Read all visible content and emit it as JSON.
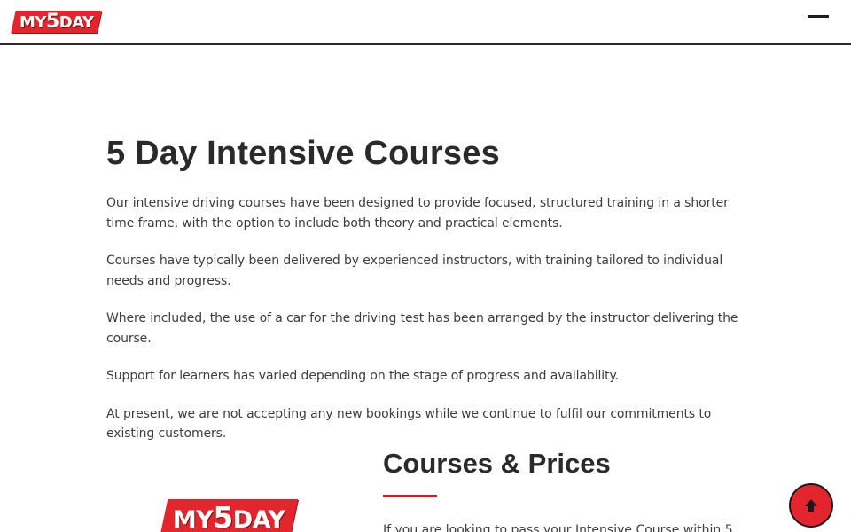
{
  "header": {
    "logo": {
      "prefix": "MY",
      "number": "5",
      "suffix": "DAY"
    },
    "menu_icon": "menu-icon"
  },
  "main": {
    "title": "5 Day Intensive Courses",
    "paragraphs": [
      "Our intensive driving courses have been designed to provide focused, structured training in a shorter time frame, with the option to include both theory and practical elements.",
      "Courses have typically been delivered by experienced instructors, with training tailored to individual needs and progress.",
      "Where included, the use of a car for the driving test has been arranged by the instructor delivering the course.",
      "Support for learners has varied depending on the stage of progress and availability.",
      "At present, we are not accepting any new bookings while we continue to fulfil our commitments to existing customers."
    ]
  },
  "courses": {
    "logo": {
      "prefix": "MY",
      "number": "5",
      "suffix": "DAY"
    },
    "heading": "Courses & Prices",
    "intro": "If you are looking to pass your Intensive Course within 5"
  },
  "back_to_top": {
    "icon": "arrow-up-icon"
  },
  "colors": {
    "brand_red": "#e3262d",
    "rule_red": "#c81e25",
    "text": "#3d3d3d"
  }
}
